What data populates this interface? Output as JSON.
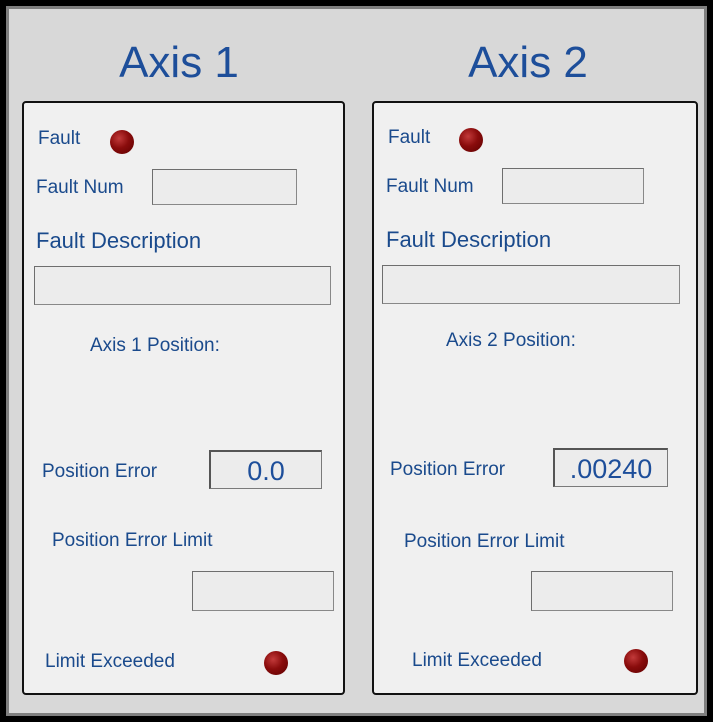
{
  "axis1": {
    "title": "Axis 1",
    "fault_label": "Fault",
    "fault_num_label": "Fault Num",
    "fault_num_value": "",
    "fault_description_label": "Fault Description",
    "fault_description_value": "",
    "position_label": "Axis 1 Position:",
    "position_error_label": "Position Error",
    "position_error_value": "0.0",
    "position_error_limit_label": "Position Error Limit",
    "position_error_limit_value": "",
    "limit_exceeded_label": "Limit Exceeded",
    "fault_indicator_color": "#8a0c0c",
    "limit_indicator_color": "#8a0c0c"
  },
  "axis2": {
    "title": "Axis 2",
    "fault_label": "Fault",
    "fault_num_label": "Fault Num",
    "fault_num_value": "",
    "fault_description_label": "Fault Description",
    "fault_description_value": "",
    "position_label": "Axis 2 Position:",
    "position_error_label": "Position Error",
    "position_error_value": ".00240",
    "position_error_limit_label": "Position Error Limit",
    "position_error_limit_value": "",
    "limit_exceeded_label": "Limit Exceeded",
    "fault_indicator_color": "#8a0c0c",
    "limit_indicator_color": "#8a0c0c"
  },
  "colors": {
    "label_blue": "#1a4a8c",
    "title_blue": "#1d4e9a",
    "background_gray": "#d8d8d8",
    "panel_gray": "#f0f0f0"
  }
}
